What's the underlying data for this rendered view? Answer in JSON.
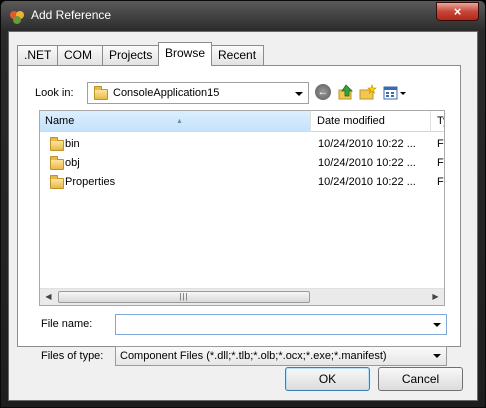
{
  "window": {
    "title": "Add Reference",
    "close_glyph": "×"
  },
  "tabs": [
    {
      "label": ".NET"
    },
    {
      "label": "COM"
    },
    {
      "label": "Projects"
    },
    {
      "label": "Browse",
      "active": true
    },
    {
      "label": "Recent"
    }
  ],
  "lookin": {
    "label": "Look in:",
    "value": "ConsoleApplication15"
  },
  "toolbar": {
    "back_icon": "back-arrow-icon",
    "up_icon": "up-folder-icon",
    "new_folder_icon": "new-folder-icon",
    "views_icon": "views-menu-icon"
  },
  "filelist": {
    "columns": {
      "name": "Name",
      "date": "Date modified",
      "type": "Ty"
    },
    "rows": [
      {
        "name": "bin",
        "date": "10/24/2010 10:22 ...",
        "type": "Fi"
      },
      {
        "name": "obj",
        "date": "10/24/2010 10:22 ...",
        "type": "Fi"
      },
      {
        "name": "Properties",
        "date": "10/24/2010 10:22 ...",
        "type": "Fi"
      }
    ],
    "scroll_left": "◀",
    "scroll_right": "▶",
    "scroll_grip": "|||"
  },
  "filename": {
    "label": "File name:",
    "value": ""
  },
  "filetype": {
    "label": "Files of type:",
    "value": "Component Files (*.dll;*.tlb;*.olb;*.ocx;*.exe;*.manifest)"
  },
  "buttons": {
    "ok": "OK",
    "cancel": "Cancel"
  }
}
